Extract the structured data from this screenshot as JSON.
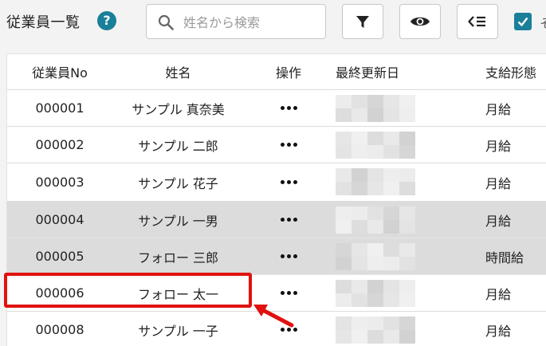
{
  "header": {
    "title": "従業員一覧",
    "help_glyph": "?",
    "search_placeholder": "姓名から検索",
    "cut_text": "そ"
  },
  "table": {
    "columns": {
      "no": "従業員No",
      "name": "姓名",
      "op": "操作",
      "updated": "最終更新日",
      "pay": "支給形態"
    },
    "rows": [
      {
        "no": "000001",
        "name": "サンプル 真奈美",
        "pay": "月給"
      },
      {
        "no": "000002",
        "name": "サンプル 二郎",
        "pay": "月給"
      },
      {
        "no": "000003",
        "name": "サンプル 花子",
        "pay": "月給"
      },
      {
        "no": "000004",
        "name": "サンプル 一男",
        "pay": "月給"
      },
      {
        "no": "000005",
        "name": "フォロー 三郎",
        "pay": "時間給"
      },
      {
        "no": "000006",
        "name": "フォロー 太一",
        "pay": "月給"
      },
      {
        "no": "000008",
        "name": "サンプル 一子",
        "pay": "月給"
      }
    ],
    "shaded_rows": [
      3,
      4
    ],
    "highlighted_row": 5
  },
  "colors": {
    "accent": "#1a7f99",
    "highlight": "#e0120f",
    "row_shade": "#dcdcdc"
  },
  "icons": {
    "search": "search-icon",
    "filter": "filter-icon",
    "eye": "eye-icon",
    "columns": "column-settings-icon",
    "check": "check-icon",
    "more": "more-dots-icon"
  }
}
